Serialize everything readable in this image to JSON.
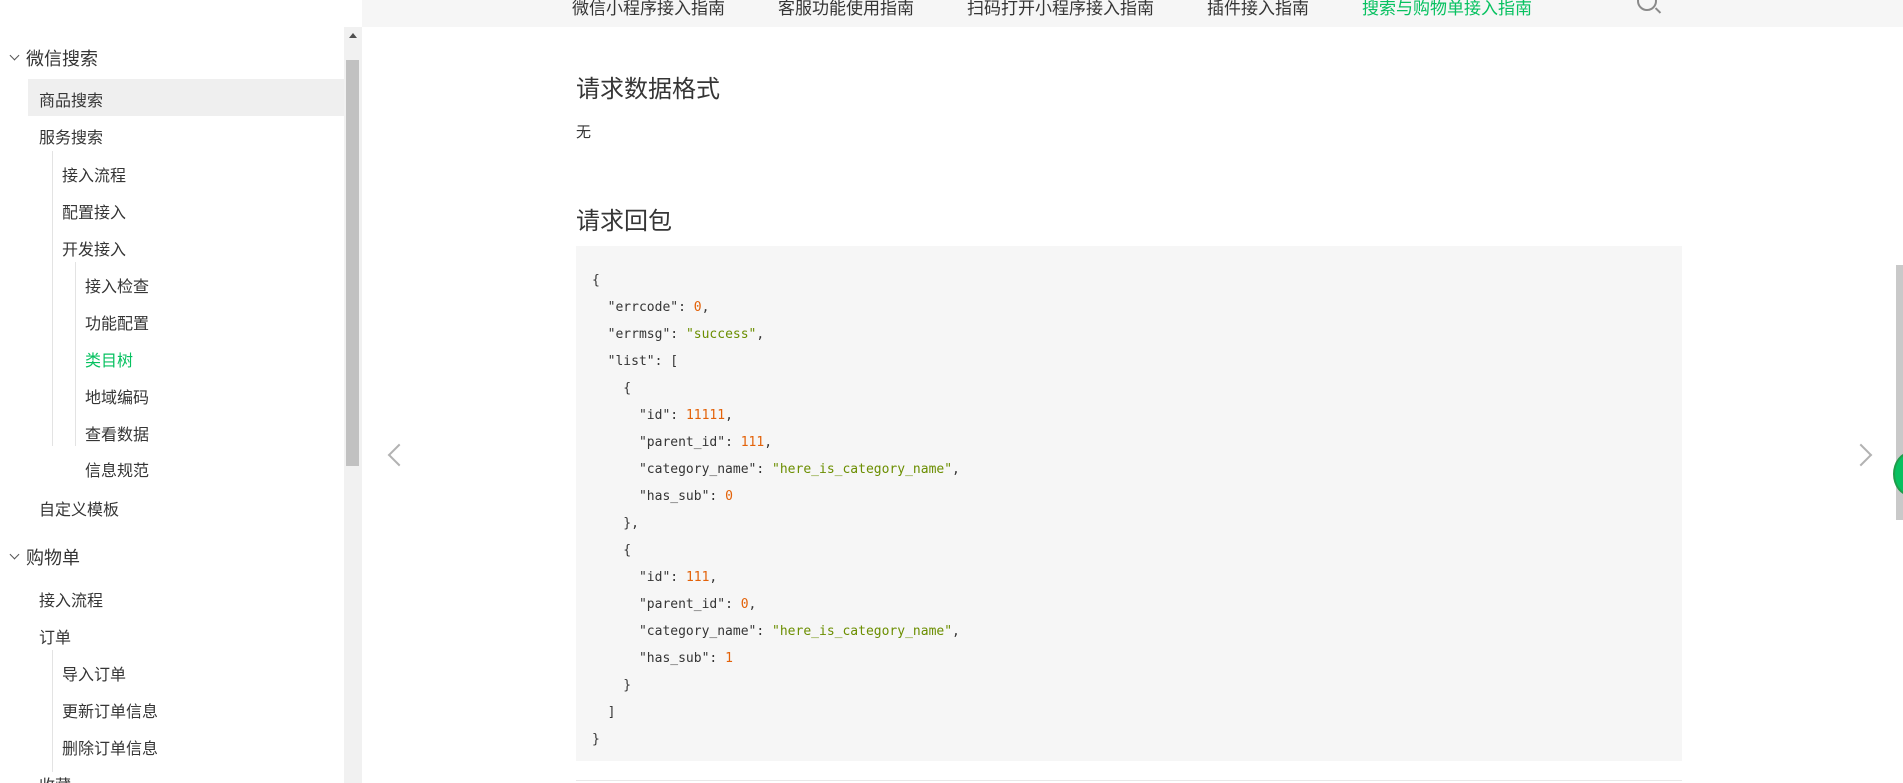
{
  "top_nav": {
    "items": [
      {
        "label": "微信小程序接入指南",
        "active": false
      },
      {
        "label": "客服功能使用指南",
        "active": false
      },
      {
        "label": "扫码打开小程序接入指南",
        "active": false
      },
      {
        "label": "插件接入指南",
        "active": false
      },
      {
        "label": "搜索与购物单接入指南",
        "active": true
      }
    ],
    "search_icon": "search-icon"
  },
  "sidebar": {
    "groups": [
      {
        "label": "微信搜索",
        "expanded": true
      },
      {
        "label": "购物单",
        "expanded": true
      }
    ],
    "items": [
      {
        "label": "商品搜索",
        "level": 1,
        "selected": true
      },
      {
        "label": "服务搜索",
        "level": 1
      },
      {
        "label": "接入流程",
        "level": 2
      },
      {
        "label": "配置接入",
        "level": 2
      },
      {
        "label": "开发接入",
        "level": 2
      },
      {
        "label": "接入检查",
        "level": 3
      },
      {
        "label": "功能配置",
        "level": 3
      },
      {
        "label": "类目树",
        "level": 3,
        "active": true
      },
      {
        "label": "地域编码",
        "level": 3
      },
      {
        "label": "查看数据",
        "level": 3
      },
      {
        "label": "信息规范",
        "level": 3
      },
      {
        "label": "自定义模板",
        "level": 1
      },
      {
        "label": "接入流程",
        "level": 1
      },
      {
        "label": "订单",
        "level": 1
      },
      {
        "label": "导入订单",
        "level": 2
      },
      {
        "label": "更新订单信息",
        "level": 2
      },
      {
        "label": "删除订单信息",
        "level": 2
      },
      {
        "label": "收藏",
        "level": 1
      }
    ]
  },
  "main": {
    "section1_title": "请求数据格式",
    "section1_text": "无",
    "section2_title": "请求回包",
    "code_lines": [
      [
        {
          "t": "{",
          "c": "p"
        }
      ],
      [
        {
          "t": "  \"errcode\"",
          "c": "k"
        },
        {
          "t": ": ",
          "c": "p"
        },
        {
          "t": "0",
          "c": "n"
        },
        {
          "t": ",",
          "c": "p"
        }
      ],
      [
        {
          "t": "  \"errmsg\"",
          "c": "k"
        },
        {
          "t": ": ",
          "c": "p"
        },
        {
          "t": "\"success\"",
          "c": "s"
        },
        {
          "t": ",",
          "c": "p"
        }
      ],
      [
        {
          "t": "  \"list\"",
          "c": "k"
        },
        {
          "t": ": [",
          "c": "p"
        }
      ],
      [
        {
          "t": "    {",
          "c": "p"
        }
      ],
      [
        {
          "t": "      \"id\"",
          "c": "k"
        },
        {
          "t": ": ",
          "c": "p"
        },
        {
          "t": "11111",
          "c": "n"
        },
        {
          "t": ",",
          "c": "p"
        }
      ],
      [
        {
          "t": "      \"parent_id\"",
          "c": "k"
        },
        {
          "t": ": ",
          "c": "p"
        },
        {
          "t": "111",
          "c": "n"
        },
        {
          "t": ",",
          "c": "p"
        }
      ],
      [
        {
          "t": "      \"category_name\"",
          "c": "k"
        },
        {
          "t": ": ",
          "c": "p"
        },
        {
          "t": "\"here_is_category_name\"",
          "c": "s"
        },
        {
          "t": ",",
          "c": "p"
        }
      ],
      [
        {
          "t": "      \"has_sub\"",
          "c": "k"
        },
        {
          "t": ": ",
          "c": "p"
        },
        {
          "t": "0",
          "c": "n"
        }
      ],
      [
        {
          "t": "    },",
          "c": "p"
        }
      ],
      [
        {
          "t": "    {",
          "c": "p"
        }
      ],
      [
        {
          "t": "      \"id\"",
          "c": "k"
        },
        {
          "t": ": ",
          "c": "p"
        },
        {
          "t": "111",
          "c": "n"
        },
        {
          "t": ",",
          "c": "p"
        }
      ],
      [
        {
          "t": "      \"parent_id\"",
          "c": "k"
        },
        {
          "t": ": ",
          "c": "p"
        },
        {
          "t": "0",
          "c": "n"
        },
        {
          "t": ",",
          "c": "p"
        }
      ],
      [
        {
          "t": "      \"category_name\"",
          "c": "k"
        },
        {
          "t": ": ",
          "c": "p"
        },
        {
          "t": "\"here_is_category_name\"",
          "c": "s"
        },
        {
          "t": ",",
          "c": "p"
        }
      ],
      [
        {
          "t": "      \"has_sub\"",
          "c": "k"
        },
        {
          "t": ": ",
          "c": "p"
        },
        {
          "t": "1",
          "c": "n"
        }
      ],
      [
        {
          "t": "    }",
          "c": "p"
        }
      ],
      [
        {
          "t": "  ]",
          "c": "p"
        }
      ],
      [
        {
          "t": "}",
          "c": "p"
        }
      ]
    ],
    "prev_icon": "chevron-left-icon",
    "next_icon": "chevron-right-icon"
  },
  "colors": {
    "accent": "#07c160",
    "number": "#e36209",
    "string": "#6b8e00",
    "text": "#353535",
    "code_bg": "#f6f6f6"
  }
}
